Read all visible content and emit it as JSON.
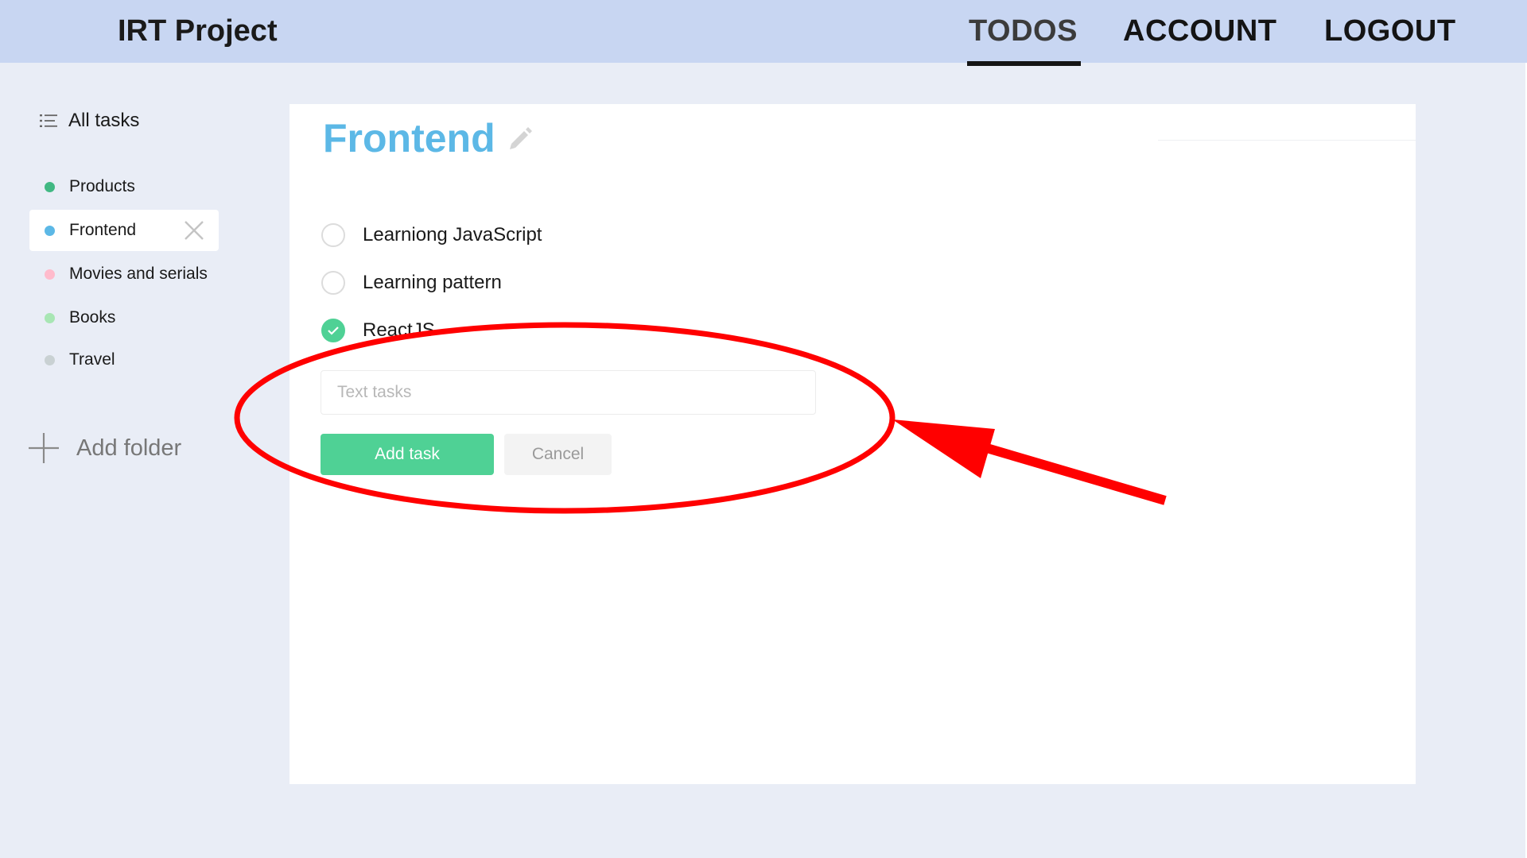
{
  "header": {
    "brand": "IRT Project",
    "nav": {
      "todos": "TODOS",
      "account": "ACCOUNT",
      "logout": "LOGOUT"
    },
    "active_nav": "TODOS"
  },
  "sidebar": {
    "all_tasks_label": "All tasks",
    "folders": [
      {
        "label": "Products",
        "color": "#41b883"
      },
      {
        "label": "Frontend",
        "color": "#5cb8e6",
        "active": true
      },
      {
        "label": "Movies and serials",
        "color": "#ffbbcc"
      },
      {
        "label": "Books",
        "color": "#a8e6b4"
      },
      {
        "label": "Travel",
        "color": "#c9d1d3"
      }
    ],
    "add_folder_label": "Add folder"
  },
  "main": {
    "title": "Frontend",
    "tasks": [
      {
        "text": "Learniong JavaScript",
        "completed": false
      },
      {
        "text": "Learning pattern",
        "completed": false
      },
      {
        "text": "ReactJS",
        "completed": true
      }
    ],
    "new_task": {
      "value": "",
      "placeholder": "Text tasks"
    },
    "add_button_label": "Add task",
    "cancel_button_label": "Cancel"
  },
  "colors": {
    "accent_green": "#4fd195",
    "title_blue": "#5cb8e6",
    "annotation_red": "#ff0000",
    "header_bg": "#c8d6f2"
  }
}
